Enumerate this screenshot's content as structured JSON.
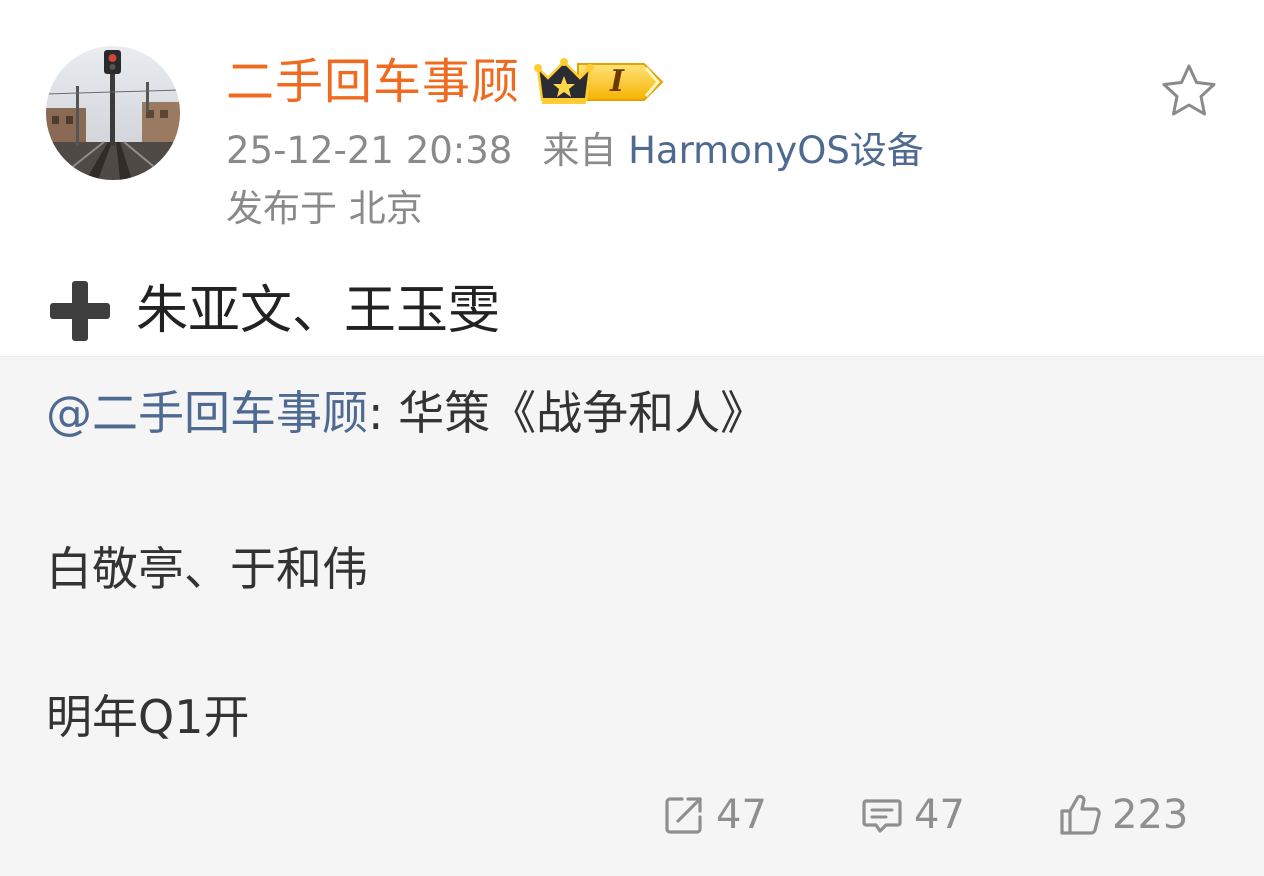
{
  "post": {
    "author": {
      "name": "二手回车事顾",
      "vip_level": "I"
    },
    "meta": {
      "timestamp": "25-12-21 20:38",
      "source_prefix": "来自",
      "source": "HarmonyOS设备",
      "location": "发布于 北京"
    },
    "text": "朱亚文、王玉雯",
    "emoji_icon": "heavy-plus-icon"
  },
  "repost": {
    "mention": "@二手回车事顾",
    "line1_rest": ": 华策《战争和人》",
    "line2": "白敬亭、于和伟",
    "line3": "明年Q1开",
    "actions": {
      "forward_count": "47",
      "comment_count": "47",
      "like_count": "223"
    }
  },
  "colors": {
    "author_name": "#f06b1f",
    "link": "#4f6a91",
    "meta_gray": "#8a8a8a",
    "repost_bg": "#f5f5f5"
  }
}
